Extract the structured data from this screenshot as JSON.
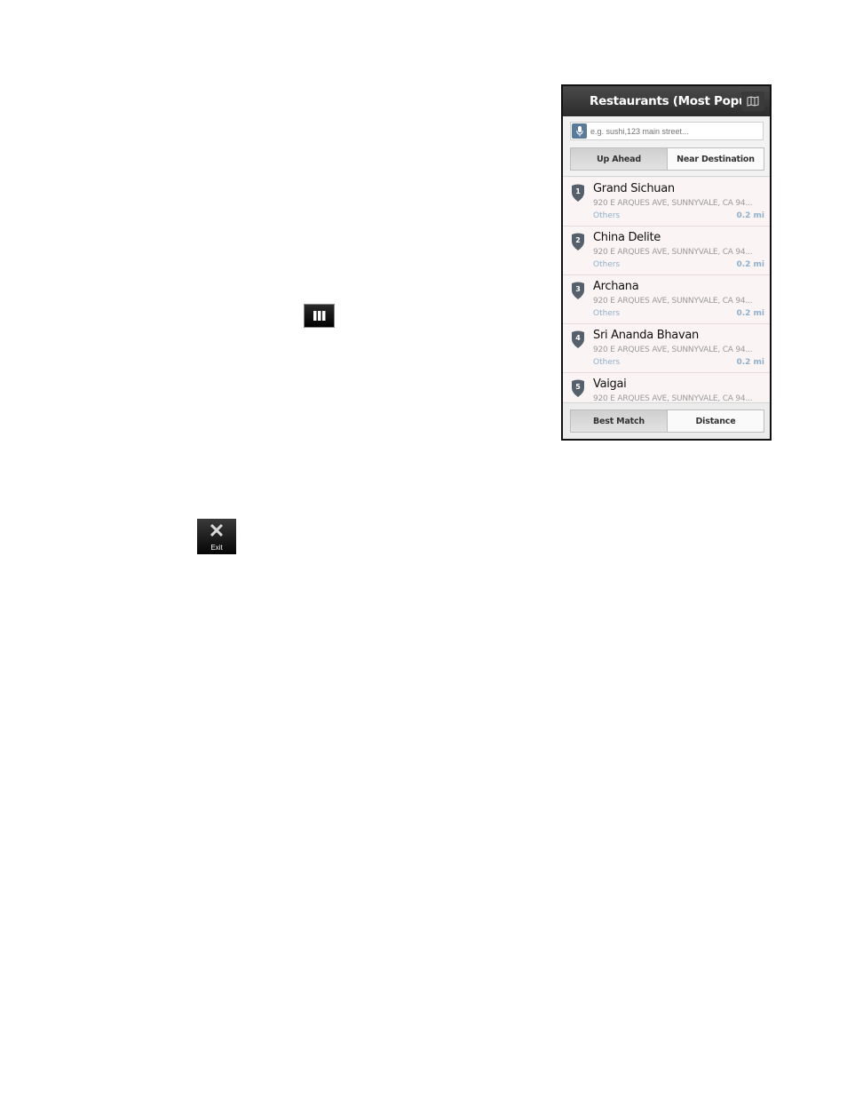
{
  "document": {
    "map_icon": "map-icon",
    "exit_icon": {
      "icon": "close-icon",
      "label": "Exit"
    }
  },
  "screen": {
    "title": "Restaurants (Most Popular",
    "map_button_icon": "map-icon",
    "search": {
      "placeholder": "e.g. sushi,123 main street...",
      "value": ""
    },
    "location_tabs": [
      "Up Ahead",
      "Near Destination"
    ],
    "location_tab_selected": "Up Ahead",
    "results": [
      {
        "rank": "1",
        "name": "Grand Sichuan",
        "address": "920 E ARQUES AVE, SUNNYVALE, CA 94...",
        "category": "Others",
        "distance": "0.2 mi"
      },
      {
        "rank": "2",
        "name": "China Delite",
        "address": "920 E ARQUES AVE, SUNNYVALE, CA 94...",
        "category": "Others",
        "distance": "0.2 mi"
      },
      {
        "rank": "3",
        "name": "Archana",
        "address": "920 E ARQUES AVE, SUNNYVALE, CA 94...",
        "category": "Others",
        "distance": "0.2 mi"
      },
      {
        "rank": "4",
        "name": "Sri Ananda Bhavan",
        "address": "920 E ARQUES AVE, SUNNYVALE, CA 94...",
        "category": "Others",
        "distance": "0.2 mi"
      },
      {
        "rank": "5",
        "name": "Vaigai",
        "address": "920 E ARQUES AVE, SUNNYVALE, CA 94...",
        "category": "",
        "distance": ""
      }
    ],
    "sort_tabs": [
      "Best Match",
      "Distance"
    ],
    "sort_tab_selected": "Best Match"
  }
}
